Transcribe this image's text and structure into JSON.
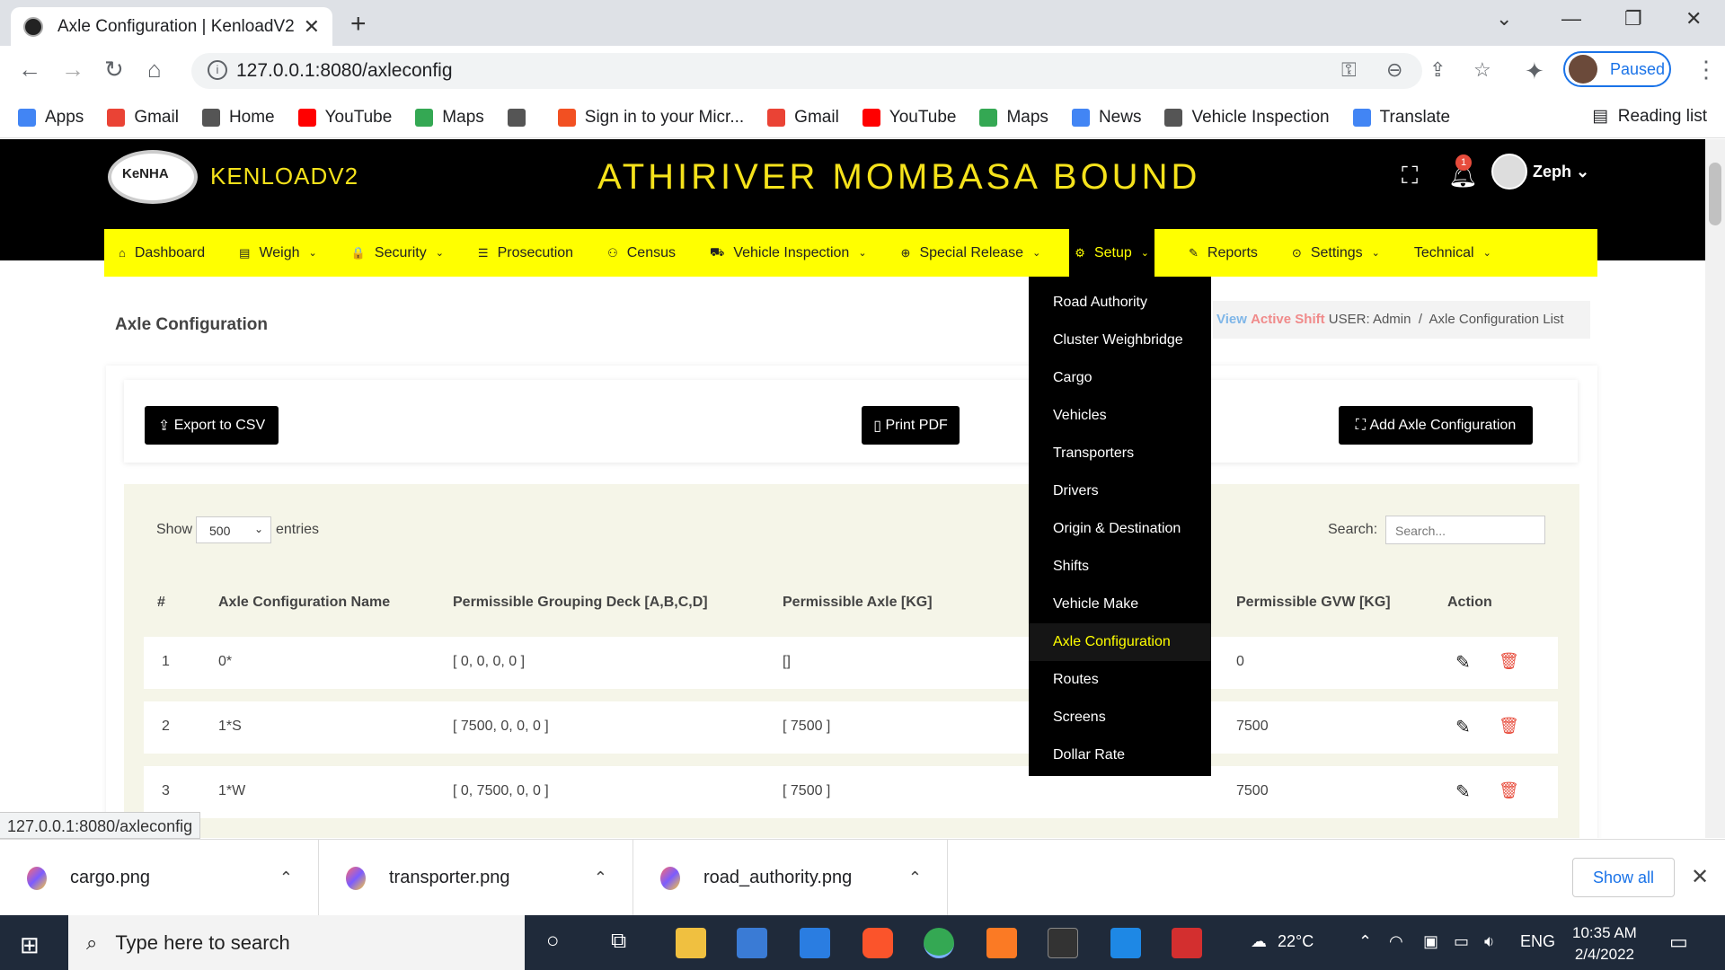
{
  "browser": {
    "tab_title": "Axle Configuration | KenloadV2",
    "url": "127.0.0.1:8080/axleconfig",
    "profile_label": "Paused",
    "bookmarks": [
      "Apps",
      "Gmail",
      "Home",
      "YouTube",
      "Maps",
      "",
      "Sign in to your Micr...",
      "Gmail",
      "YouTube",
      "Maps",
      "News",
      "Vehicle Inspection",
      "Translate"
    ],
    "reading_list": "Reading list",
    "status_url": "127.0.0.1:8080/axleconfig"
  },
  "header": {
    "logo_text": "KeNHA",
    "brand": "KENLOADV2",
    "station": "ATHIRIVER MOMBASA BOUND",
    "notification_count": "1",
    "user": "Zeph"
  },
  "menu": [
    {
      "label": "Dashboard",
      "icon": "⌂",
      "caret": false
    },
    {
      "label": "Weigh",
      "icon": "▤",
      "caret": true
    },
    {
      "label": "Security",
      "icon": "🔒",
      "caret": true
    },
    {
      "label": "Prosecution",
      "icon": "☰",
      "caret": false
    },
    {
      "label": "Census",
      "icon": "⚇",
      "caret": false
    },
    {
      "label": "Vehicle Inspection",
      "icon": "⛟",
      "caret": true
    },
    {
      "label": "Special Release",
      "icon": "⊕",
      "caret": true
    },
    {
      "label": "Setup",
      "icon": "⚙",
      "caret": true,
      "active": true
    },
    {
      "label": "Reports",
      "icon": "✎",
      "caret": false
    },
    {
      "label": "Settings",
      "icon": "⊙",
      "caret": true
    },
    {
      "label": "Technical",
      "icon": "",
      "caret": true
    }
  ],
  "setup_dropdown": [
    "Road Authority",
    "Cluster Weighbridge",
    "Cargo",
    "Vehicles",
    "Transporters",
    "Drivers",
    "Origin & Destination",
    "Shifts",
    "Vehicle Make",
    "Axle Configuration",
    "Routes",
    "Screens",
    "Dollar Rate"
  ],
  "setup_selected": "Axle Configuration",
  "page": {
    "title": "Axle Configuration",
    "breadcrumb": {
      "view": "View",
      "active_shift": "Active Shift",
      "user": "USER: Admin",
      "sep": "/",
      "current": "Axle Configuration List"
    },
    "export_csv": "Export to CSV",
    "print_pdf": "Print PDF",
    "add_btn": "Add Axle Configuration"
  },
  "table": {
    "show_label": "Show",
    "page_size": "500",
    "entries_label": "entries",
    "search_label": "Search:",
    "search_placeholder": "Search...",
    "headers": [
      "#",
      "Axle Configuration Name",
      "Permissible Grouping Deck [A,B,C,D]",
      "Permissible Axle [KG]",
      "Permissible GVW [KG]",
      "Action"
    ],
    "rows": [
      {
        "n": "1",
        "name": "0*",
        "deck": "[ 0, 0, 0, 0 ]",
        "axle": "[]",
        "gvw": "0"
      },
      {
        "n": "2",
        "name": "1*S",
        "deck": "[ 7500, 0, 0, 0 ]",
        "axle": "[ 7500 ]",
        "gvw": "7500"
      },
      {
        "n": "3",
        "name": "1*W",
        "deck": "[ 0, 7500, 0, 0 ]",
        "axle": "[ 7500 ]",
        "gvw": "7500"
      }
    ]
  },
  "downloads": {
    "files": [
      "cargo.png",
      "transporter.png",
      "road_authority.png"
    ],
    "show_all": "Show all"
  },
  "taskbar": {
    "search_placeholder": "Type here to search",
    "temp": "22°C",
    "lang": "ENG",
    "time": "10:35 AM",
    "date": "2/4/2022"
  }
}
